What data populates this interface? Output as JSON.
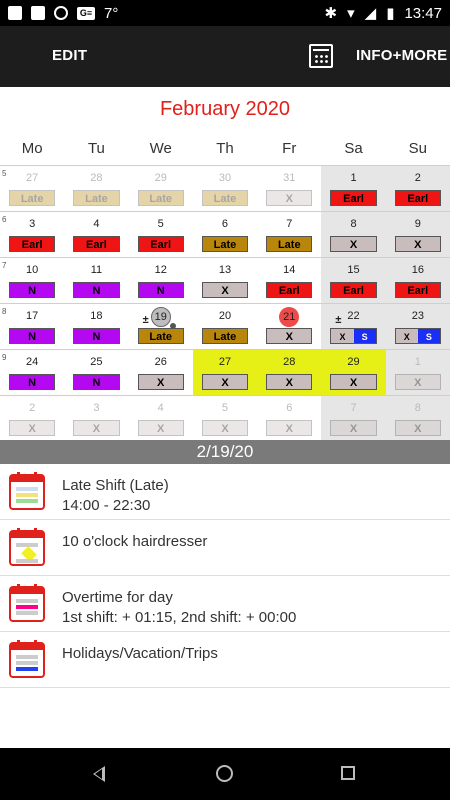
{
  "status": {
    "temp": "7°",
    "time": "13:47"
  },
  "toolbar": {
    "edit_label": "EDIT",
    "info_label": "INFO+MORE"
  },
  "calendar": {
    "month_title": "February  2020",
    "weekdays": [
      "Mo",
      "Tu",
      "We",
      "Th",
      "Fr",
      "Sa",
      "Su"
    ],
    "weeks": [
      {
        "wk": "5",
        "days": [
          {
            "n": "27",
            "b": "Late",
            "t": "late",
            "f": true
          },
          {
            "n": "28",
            "b": "Late",
            "t": "late",
            "f": true
          },
          {
            "n": "29",
            "b": "Late",
            "t": "late",
            "f": true
          },
          {
            "n": "30",
            "b": "Late",
            "t": "late",
            "f": true
          },
          {
            "n": "31",
            "b": "X",
            "t": "x",
            "f": true
          },
          {
            "n": "1",
            "b": "Earl",
            "t": "earl"
          },
          {
            "n": "2",
            "b": "Earl",
            "t": "earl"
          }
        ]
      },
      {
        "wk": "6",
        "days": [
          {
            "n": "3",
            "b": "Earl",
            "t": "earl"
          },
          {
            "n": "4",
            "b": "Earl",
            "t": "earl"
          },
          {
            "n": "5",
            "b": "Earl",
            "t": "earl"
          },
          {
            "n": "6",
            "b": "Late",
            "t": "late"
          },
          {
            "n": "7",
            "b": "Late",
            "t": "late"
          },
          {
            "n": "8",
            "b": "X",
            "t": "x"
          },
          {
            "n": "9",
            "b": "X",
            "t": "x"
          }
        ]
      },
      {
        "wk": "7",
        "days": [
          {
            "n": "10",
            "b": "N",
            "t": "n"
          },
          {
            "n": "11",
            "b": "N",
            "t": "n"
          },
          {
            "n": "12",
            "b": "N",
            "t": "n"
          },
          {
            "n": "13",
            "b": "X",
            "t": "x"
          },
          {
            "n": "14",
            "b": "Earl",
            "t": "earl"
          },
          {
            "n": "15",
            "b": "Earl",
            "t": "earl"
          },
          {
            "n": "16",
            "b": "Earl",
            "t": "earl"
          }
        ]
      },
      {
        "wk": "8",
        "days": [
          {
            "n": "17",
            "b": "N",
            "t": "n"
          },
          {
            "n": "18",
            "b": "N",
            "t": "n"
          },
          {
            "n": "19",
            "b": "Late",
            "t": "late",
            "circle": "grey",
            "pm": "±",
            "dot": true
          },
          {
            "n": "20",
            "b": "Late",
            "t": "late"
          },
          {
            "n": "21",
            "b": "X",
            "t": "x",
            "circle": "red"
          },
          {
            "n": "22",
            "b": "X",
            "s": "S",
            "t": "xs",
            "pm": "±"
          },
          {
            "n": "23",
            "b": "X",
            "s": "S",
            "t": "xs"
          }
        ]
      },
      {
        "wk": "9",
        "days": [
          {
            "n": "24",
            "b": "N",
            "t": "n"
          },
          {
            "n": "25",
            "b": "N",
            "t": "n"
          },
          {
            "n": "26",
            "b": "X",
            "t": "x"
          },
          {
            "n": "27",
            "b": "X",
            "t": "x",
            "hl": true
          },
          {
            "n": "28",
            "b": "X",
            "t": "x",
            "hl": true
          },
          {
            "n": "29",
            "b": "X",
            "t": "x",
            "hl": true
          },
          {
            "n": "1",
            "b": "X",
            "t": "x",
            "f": true
          }
        ]
      },
      {
        "wk": "",
        "days": [
          {
            "n": "2",
            "b": "X",
            "t": "x",
            "f": true
          },
          {
            "n": "3",
            "b": "X",
            "t": "x",
            "f": true
          },
          {
            "n": "4",
            "b": "X",
            "t": "x",
            "f": true
          },
          {
            "n": "5",
            "b": "X",
            "t": "x",
            "f": true
          },
          {
            "n": "6",
            "b": "X",
            "t": "x",
            "f": true
          },
          {
            "n": "7",
            "b": "X",
            "t": "x",
            "f": true
          },
          {
            "n": "8",
            "b": "X",
            "t": "x",
            "f": true
          }
        ]
      }
    ]
  },
  "selected_date": "2/19/20",
  "events": [
    {
      "icon": "shift-calendar-icon",
      "title": "Late Shift (Late)",
      "sub": "14:00 - 22:30",
      "cls": "icon-shift"
    },
    {
      "icon": "note-calendar-icon",
      "title": "10 o'clock hairdresser",
      "sub": "",
      "cls": "icon-note"
    },
    {
      "icon": "overtime-calendar-icon",
      "title": "Overtime for day",
      "sub": "1st shift: + 01:15, 2nd shift: + 00:00",
      "cls": "icon-ot"
    },
    {
      "icon": "holiday-calendar-icon",
      "title": "Holidays/Vacation/Trips",
      "sub": "",
      "cls": "icon-hol"
    }
  ],
  "colors": {
    "accent": "#e0201b",
    "earl": "#f01515",
    "late": "#b8860b",
    "night": "#b409f0",
    "off": "#c9bcbc",
    "special": "#1a2ef5",
    "today_highlight": "#e6f016"
  }
}
